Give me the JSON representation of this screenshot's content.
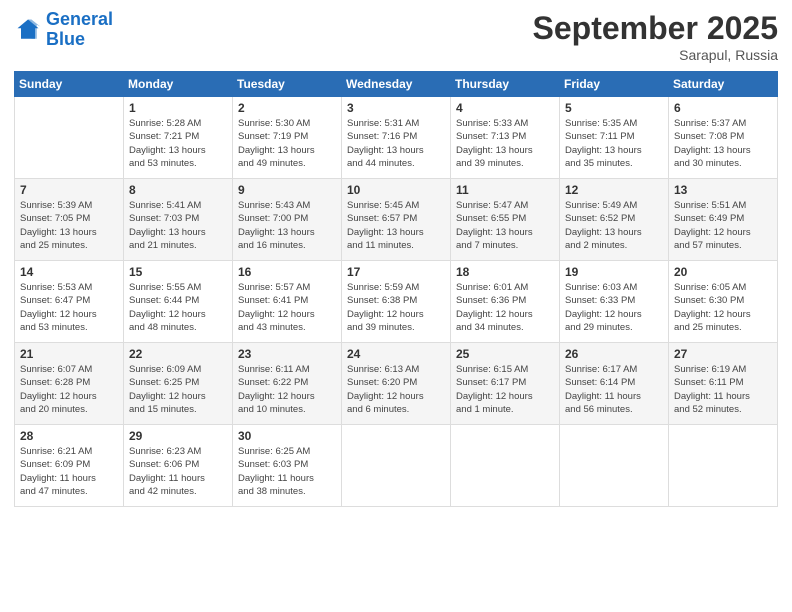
{
  "header": {
    "logo_line1": "General",
    "logo_line2": "Blue",
    "month": "September 2025",
    "location": "Sarapul, Russia"
  },
  "weekdays": [
    "Sunday",
    "Monday",
    "Tuesday",
    "Wednesday",
    "Thursday",
    "Friday",
    "Saturday"
  ],
  "weeks": [
    [
      {
        "day": "",
        "info": ""
      },
      {
        "day": "1",
        "info": "Sunrise: 5:28 AM\nSunset: 7:21 PM\nDaylight: 13 hours\nand 53 minutes."
      },
      {
        "day": "2",
        "info": "Sunrise: 5:30 AM\nSunset: 7:19 PM\nDaylight: 13 hours\nand 49 minutes."
      },
      {
        "day": "3",
        "info": "Sunrise: 5:31 AM\nSunset: 7:16 PM\nDaylight: 13 hours\nand 44 minutes."
      },
      {
        "day": "4",
        "info": "Sunrise: 5:33 AM\nSunset: 7:13 PM\nDaylight: 13 hours\nand 39 minutes."
      },
      {
        "day": "5",
        "info": "Sunrise: 5:35 AM\nSunset: 7:11 PM\nDaylight: 13 hours\nand 35 minutes."
      },
      {
        "day": "6",
        "info": "Sunrise: 5:37 AM\nSunset: 7:08 PM\nDaylight: 13 hours\nand 30 minutes."
      }
    ],
    [
      {
        "day": "7",
        "info": "Sunrise: 5:39 AM\nSunset: 7:05 PM\nDaylight: 13 hours\nand 25 minutes."
      },
      {
        "day": "8",
        "info": "Sunrise: 5:41 AM\nSunset: 7:03 PM\nDaylight: 13 hours\nand 21 minutes."
      },
      {
        "day": "9",
        "info": "Sunrise: 5:43 AM\nSunset: 7:00 PM\nDaylight: 13 hours\nand 16 minutes."
      },
      {
        "day": "10",
        "info": "Sunrise: 5:45 AM\nSunset: 6:57 PM\nDaylight: 13 hours\nand 11 minutes."
      },
      {
        "day": "11",
        "info": "Sunrise: 5:47 AM\nSunset: 6:55 PM\nDaylight: 13 hours\nand 7 minutes."
      },
      {
        "day": "12",
        "info": "Sunrise: 5:49 AM\nSunset: 6:52 PM\nDaylight: 13 hours\nand 2 minutes."
      },
      {
        "day": "13",
        "info": "Sunrise: 5:51 AM\nSunset: 6:49 PM\nDaylight: 12 hours\nand 57 minutes."
      }
    ],
    [
      {
        "day": "14",
        "info": "Sunrise: 5:53 AM\nSunset: 6:47 PM\nDaylight: 12 hours\nand 53 minutes."
      },
      {
        "day": "15",
        "info": "Sunrise: 5:55 AM\nSunset: 6:44 PM\nDaylight: 12 hours\nand 48 minutes."
      },
      {
        "day": "16",
        "info": "Sunrise: 5:57 AM\nSunset: 6:41 PM\nDaylight: 12 hours\nand 43 minutes."
      },
      {
        "day": "17",
        "info": "Sunrise: 5:59 AM\nSunset: 6:38 PM\nDaylight: 12 hours\nand 39 minutes."
      },
      {
        "day": "18",
        "info": "Sunrise: 6:01 AM\nSunset: 6:36 PM\nDaylight: 12 hours\nand 34 minutes."
      },
      {
        "day": "19",
        "info": "Sunrise: 6:03 AM\nSunset: 6:33 PM\nDaylight: 12 hours\nand 29 minutes."
      },
      {
        "day": "20",
        "info": "Sunrise: 6:05 AM\nSunset: 6:30 PM\nDaylight: 12 hours\nand 25 minutes."
      }
    ],
    [
      {
        "day": "21",
        "info": "Sunrise: 6:07 AM\nSunset: 6:28 PM\nDaylight: 12 hours\nand 20 minutes."
      },
      {
        "day": "22",
        "info": "Sunrise: 6:09 AM\nSunset: 6:25 PM\nDaylight: 12 hours\nand 15 minutes."
      },
      {
        "day": "23",
        "info": "Sunrise: 6:11 AM\nSunset: 6:22 PM\nDaylight: 12 hours\nand 10 minutes."
      },
      {
        "day": "24",
        "info": "Sunrise: 6:13 AM\nSunset: 6:20 PM\nDaylight: 12 hours\nand 6 minutes."
      },
      {
        "day": "25",
        "info": "Sunrise: 6:15 AM\nSunset: 6:17 PM\nDaylight: 12 hours\nand 1 minute."
      },
      {
        "day": "26",
        "info": "Sunrise: 6:17 AM\nSunset: 6:14 PM\nDaylight: 11 hours\nand 56 minutes."
      },
      {
        "day": "27",
        "info": "Sunrise: 6:19 AM\nSunset: 6:11 PM\nDaylight: 11 hours\nand 52 minutes."
      }
    ],
    [
      {
        "day": "28",
        "info": "Sunrise: 6:21 AM\nSunset: 6:09 PM\nDaylight: 11 hours\nand 47 minutes."
      },
      {
        "day": "29",
        "info": "Sunrise: 6:23 AM\nSunset: 6:06 PM\nDaylight: 11 hours\nand 42 minutes."
      },
      {
        "day": "30",
        "info": "Sunrise: 6:25 AM\nSunset: 6:03 PM\nDaylight: 11 hours\nand 38 minutes."
      },
      {
        "day": "",
        "info": ""
      },
      {
        "day": "",
        "info": ""
      },
      {
        "day": "",
        "info": ""
      },
      {
        "day": "",
        "info": ""
      }
    ]
  ]
}
